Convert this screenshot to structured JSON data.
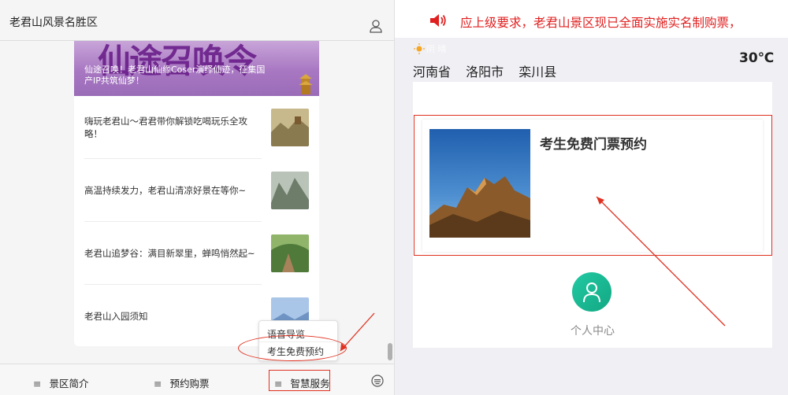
{
  "left": {
    "header": {
      "title": "老君山风景名胜区",
      "user_icon": "user-icon"
    },
    "banner": {
      "art_text": "仙途召唤令",
      "caption": "仙途召唤！老君山仙缘Coser演绎仙迹，征集国产IP共筑仙梦！"
    },
    "articles": [
      {
        "title": "嗨玩老君山～君君带你解锁吃喝玩乐全攻略！",
        "thumb_color": "#8a7a50"
      },
      {
        "title": "高温持续发力，老君山清凉好景在等你~",
        "thumb_color": "#6e7c6a"
      },
      {
        "title": "老君山追梦谷：满目新翠里，蝉鸣悄然起~",
        "thumb_color": "#4f7a3a"
      },
      {
        "title": "老君山入园须知",
        "thumb_color": "#6f94c4"
      }
    ],
    "popup": {
      "items": [
        "语音导览",
        "考生免费预约"
      ]
    },
    "tabbar": {
      "tabs": [
        "景区简介",
        "预约购票",
        "智慧服务"
      ],
      "menu_icon": "menu-icon",
      "keyboard_icon": "keyboard-icon"
    }
  },
  "right": {
    "notice": {
      "text": "应上级要求，老君山景区现已全面实施实名制购票，",
      "icon": "speaker-icon",
      "color": "#e02020"
    },
    "location": {
      "weather": "阴 晴",
      "province": "河南省",
      "city": "洛阳市",
      "county": "栾川县",
      "temperature": "30℃"
    },
    "ticket": {
      "title": "考生免费门票预约"
    },
    "user_center": {
      "label": "个人中心",
      "icon": "person-icon"
    }
  },
  "colors": {
    "annotation": "#e03020",
    "accent_green": "#1fbf98",
    "notice_red": "#e02020"
  }
}
